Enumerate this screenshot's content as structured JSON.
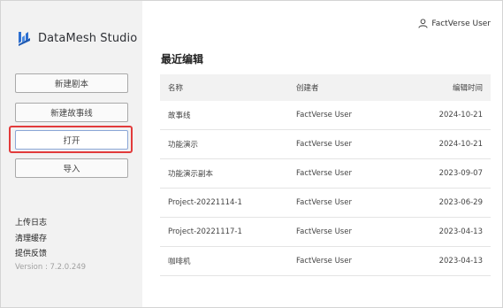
{
  "app": {
    "title": "DataMesh Studio"
  },
  "user": {
    "name": "FactVerse User"
  },
  "sidebar": {
    "buttons": [
      "新建剧本",
      "新建故事线",
      "打开",
      "导入"
    ],
    "links": [
      "上传日志",
      "清理缓存",
      "提供反馈"
    ],
    "version": "Version : 7.2.0.249"
  },
  "main": {
    "section_title": "最近编辑",
    "columns": [
      "名称",
      "创建者",
      "编辑时间"
    ],
    "rows": [
      [
        "故事线",
        "FactVerse User",
        "2024-10-21"
      ],
      [
        "功能演示",
        "FactVerse User",
        "2024-10-21"
      ],
      [
        "功能演示副本",
        "FactVerse User",
        "2023-09-07"
      ],
      [
        "Project-20221114-1",
        "FactVerse User",
        "2023-06-29"
      ],
      [
        "Project-20221117-1",
        "FactVerse User",
        "2023-04-13"
      ],
      [
        "咖啡机",
        "FactVerse User",
        "2023-04-13"
      ]
    ]
  },
  "colors": {
    "highlight": "#e23b3b",
    "logo_blue": "#2d6fd0"
  },
  "icons": {
    "logo": "datamesh-logo-icon",
    "user": "user-icon"
  }
}
